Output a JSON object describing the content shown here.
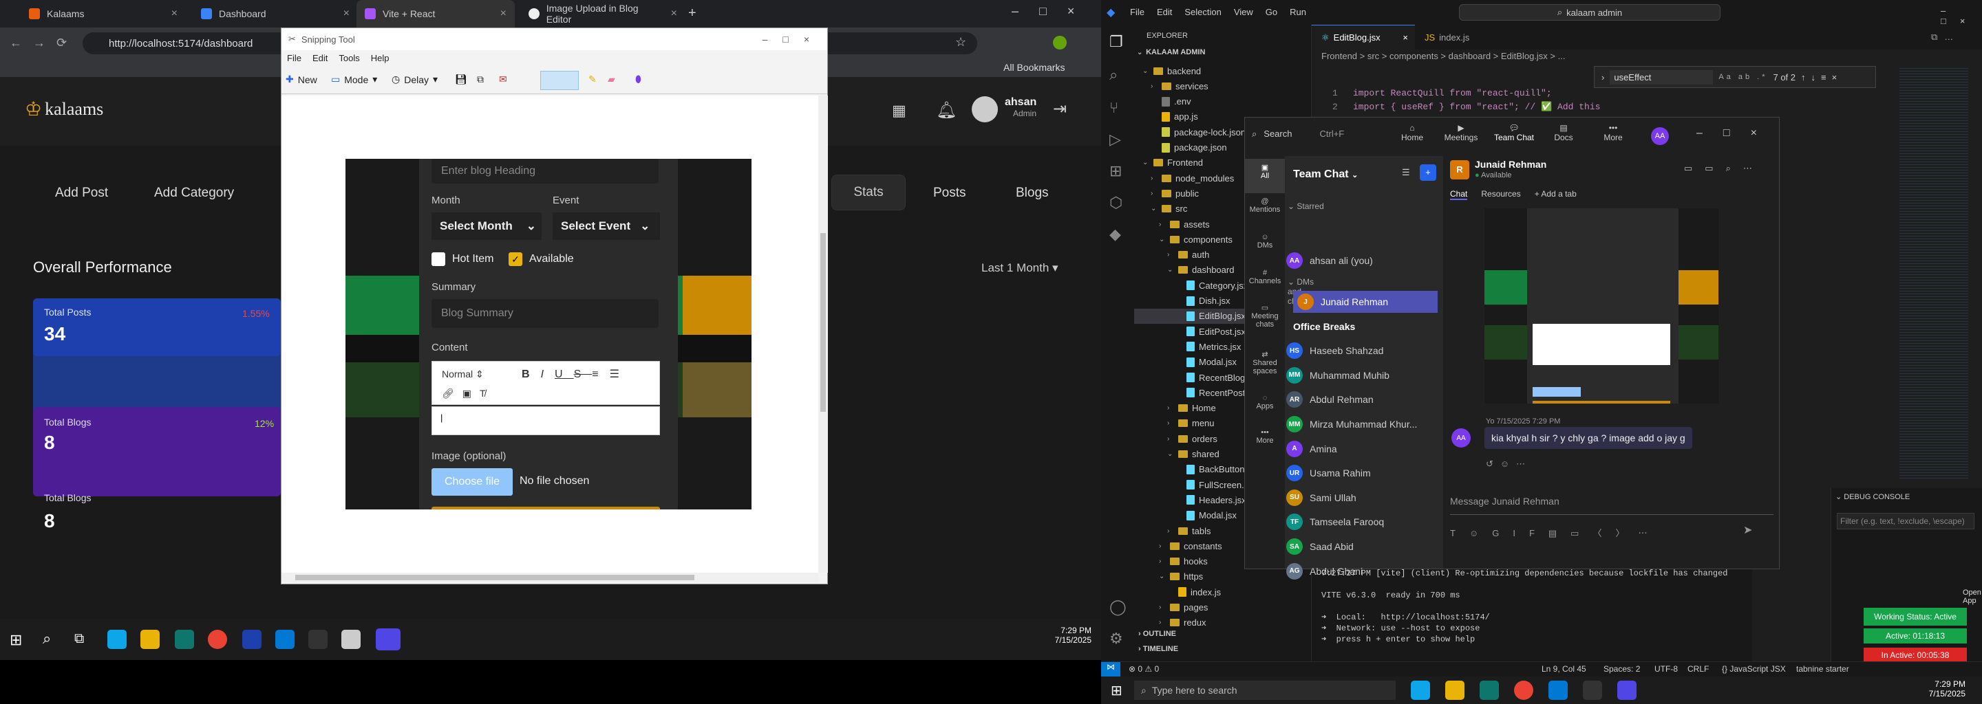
{
  "browser": {
    "tabs": [
      {
        "label": "Kalaams"
      },
      {
        "label": "Dashboard"
      },
      {
        "label": "Vite + React"
      },
      {
        "label": "Image Upload in Blog Editor"
      }
    ],
    "new_tab": "+",
    "url": "http://localhost:5174/dashboard",
    "bookmarks": "All Bookmarks"
  },
  "dashboard": {
    "logo": "kalaams",
    "user_name": "ahsan",
    "user_role": "Admin",
    "nav": [
      "Add Post",
      "Add Category",
      "Stats",
      "Posts",
      "Blogs"
    ],
    "section_title": "Overall Performance",
    "filter": "Last 1 Month",
    "cards": [
      {
        "label": "Total Posts",
        "value": "34",
        "pct": "1.55%"
      },
      {
        "label": "Total Blogs",
        "value": "8",
        "pct": "12%"
      }
    ]
  },
  "snipping": {
    "title": "Snipping Tool",
    "menu": [
      "File",
      "Edit",
      "Tools",
      "Help"
    ],
    "toolbar": {
      "new": "New",
      "mode": "Mode",
      "delay": "Delay"
    },
    "form": {
      "heading_placeholder": "Enter blog Heading",
      "month_label": "Month",
      "month_value": "Select Month",
      "event_label": "Event",
      "event_value": "Select Event",
      "hot_item": "Hot Item",
      "available": "Available",
      "summary_label": "Summary",
      "summary_placeholder": "Blog Summary",
      "content_label": "Content",
      "editor_format": "Normal",
      "image_label": "Image (optional)",
      "choose_file": "Choose file",
      "no_file": "No file chosen"
    }
  },
  "vscode": {
    "menu": [
      "File",
      "Edit",
      "Selection",
      "View",
      "Go",
      "Run"
    ],
    "search": "kalaam admin",
    "explorer_title": "EXPLORER",
    "root": "KALAAM ADMIN",
    "tabs": [
      {
        "label": "EditBlog.jsx"
      },
      {
        "label": "index.js"
      }
    ],
    "breadcrumb": "Frontend > src > components > dashboard > EditBlog.jsx > ...",
    "find_value": "useEffect",
    "find_count": "7 of 2",
    "code": [
      "import ReactQuill from \"react-quill\";",
      "import { useRef } from \"react\"; // ✅ Add this"
    ],
    "tree": [
      {
        "label": "backend",
        "type": "folder",
        "depth": 0,
        "open": true
      },
      {
        "label": "services",
        "type": "folder",
        "depth": 1,
        "open": false
      },
      {
        "label": ".env",
        "type": "file",
        "depth": 1
      },
      {
        "label": "app.js",
        "type": "file",
        "depth": 1
      },
      {
        "label": "package-lock.json",
        "type": "file",
        "depth": 1
      },
      {
        "label": "package.json",
        "type": "file",
        "depth": 1
      },
      {
        "label": "Frontend",
        "type": "folder",
        "depth": 0,
        "open": true
      },
      {
        "label": "node_modules",
        "type": "folder",
        "depth": 1,
        "open": false
      },
      {
        "label": "public",
        "type": "folder",
        "depth": 1,
        "open": false
      },
      {
        "label": "src",
        "type": "folder",
        "depth": 1,
        "open": true
      },
      {
        "label": "assets",
        "type": "folder",
        "depth": 2,
        "open": false
      },
      {
        "label": "components",
        "type": "folder",
        "depth": 2,
        "open": true
      },
      {
        "label": "auth",
        "type": "folder",
        "depth": 3,
        "open": false
      },
      {
        "label": "dashboard",
        "type": "folder",
        "depth": 3,
        "open": true
      },
      {
        "label": "Category.jsx",
        "type": "file",
        "depth": 4
      },
      {
        "label": "Dish.jsx",
        "type": "file",
        "depth": 4
      },
      {
        "label": "EditBlog.jsx",
        "type": "file",
        "depth": 4
      },
      {
        "label": "EditPost.jsx",
        "type": "file",
        "depth": 4
      },
      {
        "label": "Metrics.jsx",
        "type": "file",
        "depth": 4
      },
      {
        "label": "Modal.jsx",
        "type": "file",
        "depth": 4
      },
      {
        "label": "RecentBlog...",
        "type": "file",
        "depth": 4
      },
      {
        "label": "RecentPost...",
        "type": "file",
        "depth": 4
      },
      {
        "label": "Home",
        "type": "folder",
        "depth": 3,
        "open": false
      },
      {
        "label": "menu",
        "type": "folder",
        "depth": 3,
        "open": false
      },
      {
        "label": "orders",
        "type": "folder",
        "depth": 3,
        "open": false
      },
      {
        "label": "shared",
        "type": "folder",
        "depth": 3,
        "open": true
      },
      {
        "label": "BackButton...",
        "type": "file",
        "depth": 4
      },
      {
        "label": "FullScreen...",
        "type": "file",
        "depth": 4
      },
      {
        "label": "Headers.jsx",
        "type": "file",
        "depth": 4
      },
      {
        "label": "Modal.jsx",
        "type": "file",
        "depth": 4
      },
      {
        "label": "tabls",
        "type": "folder",
        "depth": 3,
        "open": false
      },
      {
        "label": "constants",
        "type": "folder",
        "depth": 2,
        "open": false
      },
      {
        "label": "hooks",
        "type": "folder",
        "depth": 2,
        "open": false
      },
      {
        "label": "https",
        "type": "folder",
        "depth": 2,
        "open": true
      },
      {
        "label": "index.js",
        "type": "file",
        "depth": 3
      },
      {
        "label": "pages",
        "type": "folder",
        "depth": 2,
        "open": false
      },
      {
        "label": "redux",
        "type": "folder",
        "depth": 2,
        "open": false
      }
    ],
    "outline": "OUTLINE",
    "timeline": "TIMELINE",
    "terminal": [
      "7:27:27 PM [vite] (client) Re-optimizing dependencies because lockfile has changed",
      "",
      "VITE v6.3.0  ready in 700 ms",
      "",
      "➜  Local:   http://localhost:5174/",
      "➜  Network: use --host to expose",
      "➜  press h + enter to show help"
    ],
    "debug_console": "DEBUG CONSOLE",
    "filter_placeholder": "Filter (e.g. text, !exclude, \\escape)",
    "open_app": "Open App",
    "status_working": "Working Status: Active",
    "status_active": "Active: 01:18:13",
    "status_inactive": "In Active: 00:05:38",
    "status_bar": {
      "errors": "⊗ 0 ⚠ 0",
      "ln_col": "Ln 9, Col 45",
      "spaces": "Spaces: 2",
      "encoding": "UTF-8",
      "eol": "CRLF",
      "lang": "{} JavaScript JSX",
      "tabnine": "tabnine starter"
    }
  },
  "teams": {
    "search": "Search",
    "search_shortcut": "Ctrl+F",
    "top_nav": [
      "Home",
      "Meetings",
      "Team Chat",
      "Docs",
      "More"
    ],
    "avatar": "AA",
    "rail": [
      "All",
      "Mentions",
      "DMs",
      "Channels",
      "Meeting chats",
      "Shared spaces",
      "Apps",
      "More"
    ],
    "chat_title": "Team Chat",
    "starred": "Starred",
    "me": "ahsan ali (you)",
    "dms_heading": "DMs and channels",
    "contacts": [
      {
        "name": "Junaid Rehman",
        "initials": "J",
        "color": "#d97706"
      },
      {
        "name": "Office Breaks",
        "initials": "",
        "color": ""
      },
      {
        "name": "Haseeb Shahzad",
        "initials": "HS",
        "color": "#2563eb"
      },
      {
        "name": "Muhammad Muhib",
        "initials": "MM",
        "color": "#0d9488"
      },
      {
        "name": "Abdul Rehman",
        "initials": "AR",
        "color": "#475569"
      },
      {
        "name": "Mirza Muhammad Khur...",
        "initials": "MM",
        "color": "#16a34a"
      },
      {
        "name": "Amina",
        "initials": "A",
        "color": "#7c3aed"
      },
      {
        "name": "Usama Rahim",
        "initials": "UR",
        "color": "#2563eb"
      },
      {
        "name": "Sami Ullah",
        "initials": "SU",
        "color": "#ca8a04"
      },
      {
        "name": "Tamseela Farooq",
        "initials": "TF",
        "color": "#0d9488"
      },
      {
        "name": "Saad Abid",
        "initials": "SA",
        "color": "#16a34a"
      },
      {
        "name": "Abdul Ghani",
        "initials": "AG",
        "color": "#64748b"
      }
    ],
    "contact_name": "Junaid Rehman",
    "contact_status": "Available",
    "tabs": [
      "Chat",
      "Resources",
      "+ Add a tab"
    ],
    "message_time": "Yo 7/15/2025 7:29 PM",
    "message": "kia khyal h sir ? y chly ga ? image add o jay g",
    "compose_placeholder": "Message Junaid Rehman"
  },
  "taskbar": {
    "time": "7:29 PM",
    "date": "7/15/2025",
    "search_placeholder": "Type here to search"
  }
}
